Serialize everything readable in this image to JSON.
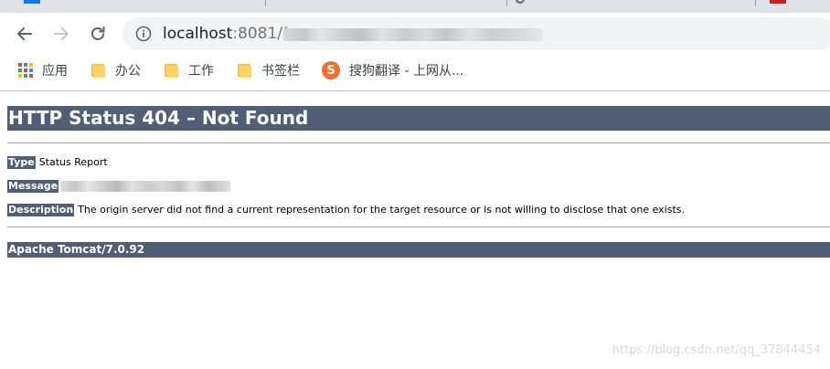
{
  "browser": {
    "address_bar": {
      "url_host": "localhost",
      "url_port": ":8081/",
      "url_path_visible": "("
    },
    "bookmarks": [
      {
        "label": "应用",
        "icon": "apps-grid-icon"
      },
      {
        "label": "办公",
        "icon": "folder-icon"
      },
      {
        "label": "工作",
        "icon": "folder-icon"
      },
      {
        "label": "书签栏",
        "icon": "folder-icon"
      },
      {
        "label": "搜狗翻译 - 上网从...",
        "icon": "sogou-icon",
        "icon_glyph": "S"
      }
    ],
    "colors": {
      "tabstrip": "#dee1e6",
      "omnibox": "#f1f3f4",
      "folder": "#ffd561",
      "sogou": "#f36f2b"
    }
  },
  "page": {
    "title": "HTTP Status 404 – Not Found",
    "details": {
      "type_label": "Type",
      "type_value": "Status Report",
      "message_label": "Message",
      "description_label": "Description",
      "description_value": "The origin server did not find a current representation for the target resource or is not willing to disclose that one exists."
    },
    "footer": "Apache Tomcat/7.0.92",
    "colors": {
      "header_bg": "#525d76",
      "header_text": "#ffffff"
    }
  },
  "watermark": "https://blog.csdn.net/qq_37844454"
}
